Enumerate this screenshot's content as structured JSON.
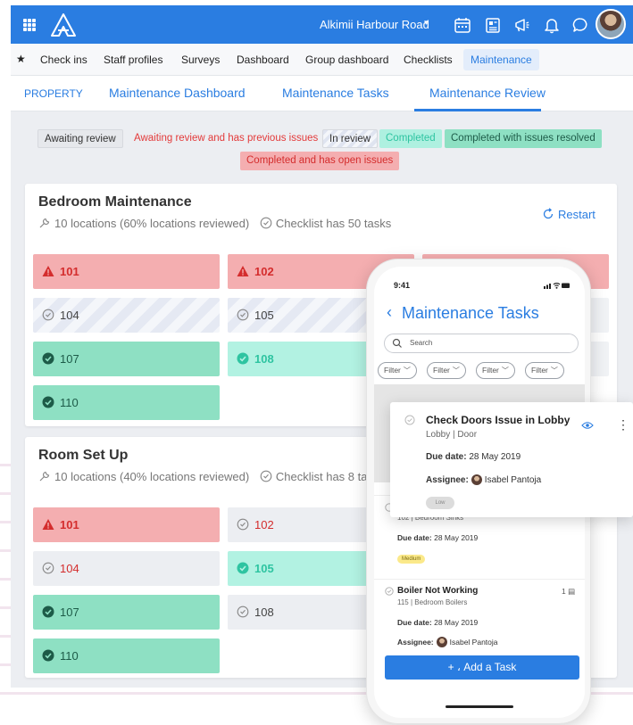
{
  "topbar": {
    "site_name": "Alkimii Harbour Road",
    "site_caret": "▾",
    "icons": [
      "apps-grid-icon",
      "logo",
      "calendar-icon",
      "news-icon",
      "megaphone-icon",
      "bell-icon",
      "chat-icon",
      "avatar"
    ]
  },
  "mainnav": {
    "star": "★",
    "items": [
      "Check ins",
      "Staff profiles",
      "Surveys",
      "Dashboard",
      "Group dashboard",
      "Checklists",
      "Maintenance"
    ],
    "active": "Maintenance"
  },
  "subnav": {
    "items": [
      "PROPERTY",
      "Maintenance Dashboard",
      "Maintenance Tasks",
      "Maintenance Review"
    ],
    "active": "Maintenance Review"
  },
  "legend": {
    "awaiting": "Awaiting review",
    "awaiting_prev": "Awaiting review and has previous issues",
    "in_review": "In review",
    "completed": "Completed",
    "completed_resolved": "Completed with issues resolved",
    "completed_open": "Completed and has open issues"
  },
  "cards": [
    {
      "title": "Bedroom Maintenance",
      "locations": "10 locations (60% locations reviewed)",
      "checklist": "Checklist has 50 tasks",
      "restart": "Restart",
      "tiles": [
        {
          "label": "101",
          "status": "open-issues"
        },
        {
          "label": "102",
          "status": "open-issues"
        },
        {
          "label": "",
          "status": "open-issues"
        },
        {
          "label": "104",
          "status": "in-review"
        },
        {
          "label": "105",
          "status": "in-review"
        },
        {
          "label": "107",
          "status": "completed-resolved"
        },
        {
          "label": "108",
          "status": "completed"
        },
        {
          "label": "110",
          "status": "completed-resolved"
        }
      ]
    },
    {
      "title": "Room Set Up",
      "locations": "10 locations (40% locations reviewed)",
      "checklist": "Checklist has 8 tasks",
      "tiles": [
        {
          "label": "101",
          "status": "open-issues"
        },
        {
          "label": "102",
          "status": "awaiting-prev"
        },
        {
          "label": "104",
          "status": "awaiting-prev"
        },
        {
          "label": "105",
          "status": "completed"
        },
        {
          "label": "107",
          "status": "completed-resolved"
        },
        {
          "label": "108",
          "status": "awaiting"
        },
        {
          "label": "110",
          "status": "completed-resolved"
        }
      ]
    }
  ],
  "phone": {
    "time": "9:41",
    "back": "‹",
    "title": "Maintenance Tasks",
    "search_placeholder": "Search",
    "filters": [
      "Filter",
      "Filter",
      "Filter",
      "Filter"
    ],
    "items": [
      {
        "location": "102 | Bedroom Sinks",
        "due_label": "Due date:",
        "due": "28 May 2019",
        "priority": "Medium"
      },
      {
        "title": "Boiler Not Working",
        "location": "115 | Bedroom Boilers",
        "count": "1",
        "due_label": "Due date:",
        "due": "28 May 2019",
        "assignee_label": "Assignee:",
        "assignee": "Isabel Pantoja"
      }
    ],
    "add_task": "+ ، Add a Task"
  },
  "popout": {
    "title": "Check Doors Issue in Lobby",
    "location": "Lobby | Door",
    "due_label": "Due date:",
    "due": "28 May 2019",
    "assignee_label": "Assignee:",
    "assignee": "Isabel Pantoja",
    "priority": "Low",
    "more": "⋮"
  },
  "colors": {
    "brand_blue": "#2a7de1",
    "red_tile": "#f4aeb0",
    "red_text": "#d42d2d",
    "green_tile": "#8ee0c3",
    "mint_tile": "#b2f2e2",
    "grey_tile": "#eceef2"
  }
}
